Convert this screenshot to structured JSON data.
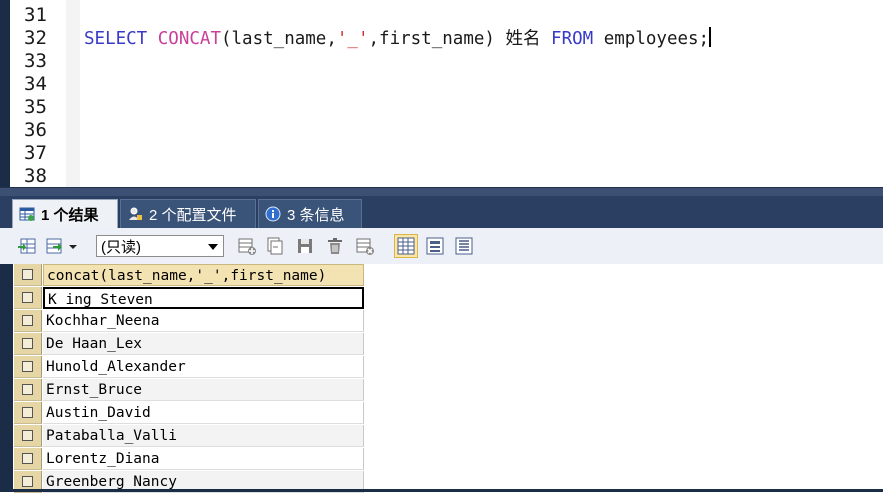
{
  "editor": {
    "line_numbers": [
      "31",
      "32",
      "33",
      "34",
      "35",
      "36",
      "37",
      "38"
    ],
    "top_fragment": "        ",
    "code": {
      "kw_select": "SELECT",
      "fn_concat": "CONCAT",
      "part_open": "(last_name,",
      "str_underscore": "'_'",
      "part_close": ",first_name)",
      "alias": "姓名",
      "kw_from": "FROM",
      "table": "employees;"
    }
  },
  "tabs": [
    {
      "label": "1 个结果",
      "icon": "table-result-icon",
      "active": true
    },
    {
      "label": "2 个配置文件",
      "icon": "profile-icon",
      "active": false
    },
    {
      "label": "3 条信息",
      "icon": "info-icon",
      "active": false
    }
  ],
  "toolbar": {
    "readonly_label": "(只读)",
    "icons": [
      "export-grid-icon",
      "import-icon",
      "readonly-dropdown",
      "insert-row-icon",
      "duplicate-row-icon",
      "save-icon",
      "delete-icon",
      "cancel-icon",
      "grid-view-icon",
      "form-view-icon",
      "text-view-icon"
    ]
  },
  "grid": {
    "column_header": "concat(last_name,'_',first_name)",
    "rows": [
      "K_ing_Steven",
      "Kochhar_Neena",
      "De Haan_Lex",
      "Hunold_Alexander",
      "Ernst_Bruce",
      "Austin_David",
      "Pataballa_Valli",
      "Lorentz_Diana",
      "Greenberg_Nancy"
    ]
  },
  "colors": {
    "keyword": "#3a3ac8",
    "function": "#c8409a",
    "string": "#c83232",
    "frame": "#1b2c46",
    "header_cell": "#f3e3b3"
  }
}
